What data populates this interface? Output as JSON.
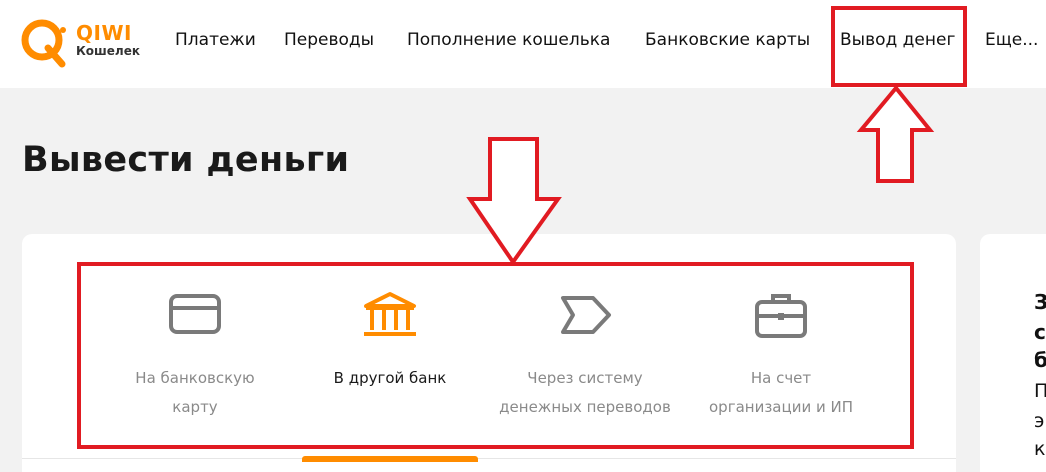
{
  "logo": {
    "brand": "QIWI",
    "sub": "Кошелек",
    "color": "#ff8c00"
  },
  "nav": {
    "items": [
      "Платежи",
      "Переводы",
      "Пополнение кошелька",
      "Банковские карты",
      "Вывод денег",
      "Еще..."
    ]
  },
  "page": {
    "title": "Вывести деньги"
  },
  "options": [
    {
      "icon": "credit-card-icon",
      "label": "На банковскую\nкарту",
      "active": false
    },
    {
      "icon": "bank-icon",
      "label": "В другой банк",
      "active": true
    },
    {
      "icon": "arrow-tag-icon",
      "label": "Через систему\nденежных переводов",
      "active": false
    },
    {
      "icon": "briefcase-icon",
      "label": "На счет\nорганизации и ИП",
      "active": false
    }
  ],
  "right_card": {
    "lines": [
      "З",
      "с",
      "б",
      "П",
      "э",
      "к"
    ]
  },
  "colors": {
    "accent": "#ff8c00",
    "annotation": "#e11b22",
    "icon_gray": "#7a7a7a"
  }
}
